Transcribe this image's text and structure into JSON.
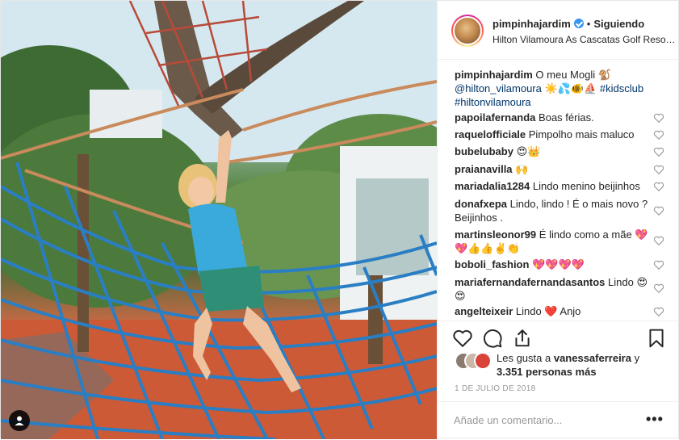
{
  "photo": {
    "description_icon": "user-tag-icon"
  },
  "header": {
    "username": "pimpinhajardim",
    "separator": "•",
    "follow_label": "Siguiendo",
    "location": "Hilton Vilamoura As Cascatas Golf Reso…"
  },
  "caption": {
    "username": "pimpinhajardim",
    "text": "O meu Mogli 🐒",
    "mention": "@hilton_vilamoura",
    "emojis": "☀️💦🐠⛵",
    "hashtag1": "#kidsclub",
    "hashtag2": "#hiltonvilamoura"
  },
  "comments": [
    {
      "user": "papoilafernanda",
      "text": "Boas férias."
    },
    {
      "user": "raquelofficiale",
      "text": "Pimpolho mais maluco"
    },
    {
      "user": "bubelubaby",
      "text": "😍👑"
    },
    {
      "user": "praianavilla",
      "text": "🙌"
    },
    {
      "user": "mariadalia1284",
      "text": "Lindo menino beijinhos"
    },
    {
      "user": "donafxepa",
      "text": "Lindo, lindo ! É o mais novo ?Beijinhos ."
    },
    {
      "user": "martinsleonor99",
      "text": "É lindo como a mãe 💖💖👍👍✌️👏"
    },
    {
      "user": "boboli_fashion",
      "text": "💖💖💖💖"
    },
    {
      "user": "mariafernandafernandasantos",
      "text": "Lindo 😍😍"
    },
    {
      "user": "angelteixeir",
      "text": "Lindo ❤️ Anjo"
    }
  ],
  "likes": {
    "prefix": "Les gusta a",
    "user": "vanessaferreira",
    "middle": "y",
    "count": "3.351 personas más"
  },
  "date": "1 DE JULIO DE 2018",
  "add_comment": {
    "placeholder": "Añade un comentario...",
    "more": "•••"
  },
  "icons": [
    "heart-icon",
    "comment-icon",
    "share-icon",
    "bookmark-icon",
    "verified-badge-icon"
  ],
  "colors": {
    "verified": "#3897f0",
    "link": "#003569",
    "text": "#262626",
    "muted": "#999999",
    "heart_red": "#ed4956"
  }
}
